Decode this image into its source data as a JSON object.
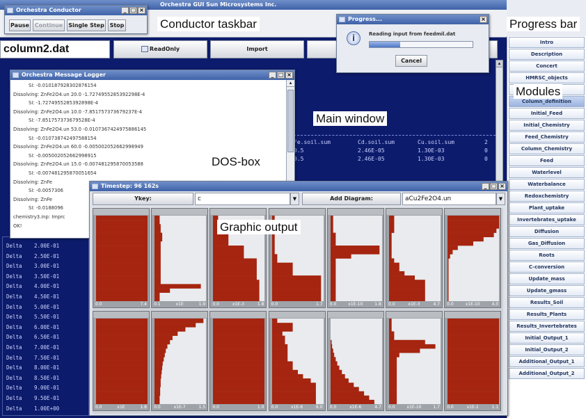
{
  "conductor": {
    "buttons": [
      "Pause",
      "Continue",
      "Single Step",
      "Stop"
    ],
    "annotation": "Conductor taskbar"
  },
  "main": {
    "title": "column2.dat",
    "readonly_label": "ReadOnly",
    "import_label": "Import",
    "annotation": "Main window",
    "table_rows": [
      [
        "Fe.soil.sum",
        "Cd.soil.sum",
        "Cu.soil.sum",
        "2"
      ],
      [
        "0.5",
        "2.46E-05",
        "1.30E-03",
        "0"
      ],
      [
        "0.5",
        "2.46E-05",
        "1.30E-03",
        "0"
      ]
    ]
  },
  "progress": {
    "title": "Progress...",
    "message": "Reading input from feedmil.dat",
    "cancel_label": "Cancel",
    "annotation": "Progress bar",
    "fraction": 0.3
  },
  "modules": {
    "annotation": "Modules",
    "items": [
      "Intro",
      "Description",
      "Concert",
      "HMRSC_objects",
      "",
      "Column_definition",
      "Initial_Feed",
      "Initial_Chemistry",
      "Feed_Chemistry",
      "Column_Chemistry",
      "Feed",
      "Waterlevel",
      "Waterbalance",
      "Redoxchemistry",
      "Plant_uptake",
      "Invertebrates_uptake",
      "Diffusion",
      "Gas_Diffusion",
      "Roots",
      "C-conversion",
      "Update_mass",
      "Update_gmass",
      "Results_Soil",
      "Results_Plants",
      "Results_Invertebrates",
      "Initial_Output_1",
      "Initial_Output_2",
      "Additional_Output_1",
      "Additional_Output_2"
    ]
  },
  "logger": {
    "title": "Orchestra Message Logger",
    "annotation": "DOS-box",
    "lines": [
      "SI: -0.010187928302876154",
      "Dissolving: ZnFe2O4.un 20.0 -1.7274955285392298E-4",
      "SI: -1.7274955285392898E-4",
      "Dissolving: ZnFe2O4.un 10.0 -7.851757373679237E-4",
      "SI: -7.851757373679528E-4",
      "Dissolving: ZnFe2O4.un 53.0 -0.0107367424975886145",
      "SI: -0.010738742497588154",
      "Dissolving: ZnFe2O4.un 60.0 -0.005002052662998949",
      "SI: -0.005002052662998915",
      "Dissolving: ZnFe2O4.un 15.0 -0.007481295870053588",
      "SI: -0.007481295870051654",
      "Dissolving: ZnFe",
      "SI: -0.0057306",
      "Dissolving: ZnFe",
      "SI: -0.0188096",
      "chemistry3.inp: Imprc",
      "OK!"
    ]
  },
  "dos": {
    "rows": [
      [
        "Delta",
        "2.00E-01"
      ],
      [
        "Delta",
        "2.50E-01"
      ],
      [
        "Delta",
        "3.00E-01"
      ],
      [
        "Delta",
        "3.50E-01"
      ],
      [
        "Delta",
        "4.00E-01"
      ],
      [
        "Delta",
        "4.50E-01"
      ],
      [
        "Delta",
        "5.00E-01"
      ],
      [
        "Delta",
        "5.50E-01"
      ],
      [
        "Delta",
        "6.00E-01"
      ],
      [
        "Delta",
        "6.50E-01"
      ],
      [
        "Delta",
        "7.00E-01"
      ],
      [
        "Delta",
        "7.50E-01"
      ],
      [
        "Delta",
        "8.00E-01"
      ],
      [
        "Delta",
        "8.50E-01"
      ],
      [
        "Delta",
        "9.00E-01"
      ],
      [
        "Delta",
        "9.50E-01"
      ],
      [
        "Delta",
        "1.00E+00"
      ]
    ]
  },
  "graphic": {
    "title": "Timestep: 96 162s",
    "ykey_label": "Ykey:",
    "ykey_value": "c",
    "add_label": "Add Diagram:",
    "add_value": "aCu2Fe2O4.un",
    "annotation": "Graphic output",
    "fill_color": "#a52510",
    "cells": [
      {
        "axis": [
          "0.0",
          "",
          "7.4"
        ],
        "profile": [
          1,
          1,
          1,
          1,
          1,
          1,
          1,
          1,
          1,
          1,
          1,
          1,
          1,
          1,
          1,
          1,
          1,
          1,
          1,
          1
        ]
      },
      {
        "axis": [
          "0.1",
          "x1E",
          "1.9"
        ],
        "profile": [
          0.1,
          0.1,
          0.12,
          0.12,
          0.15,
          0.15,
          0.12,
          0.12,
          0.12,
          0.12,
          0.12,
          0.12,
          0.12,
          0.12,
          0.12,
          0.12,
          0.9,
          0.3,
          0.1,
          0.1
        ]
      },
      {
        "axis": [
          "0.0",
          "x1E-3",
          "1.8"
        ],
        "profile": [
          0.1,
          0.1,
          0.1,
          0.1,
          0.3,
          0.3,
          0.3,
          0.6,
          0.6,
          0.6,
          0.85,
          0.85,
          0.85,
          0.85,
          0.85,
          0.9,
          0.9,
          0.9,
          0.9,
          0.9
        ]
      },
      {
        "axis": [
          "0.0",
          "",
          "1.7"
        ],
        "profile": [
          0.05,
          0.05,
          0.05,
          0.05,
          0.05,
          0.05,
          0.05,
          0.05,
          0.05,
          0.1,
          0.1,
          0.4,
          0.4,
          0.4,
          0.95,
          0.95,
          0.95,
          0.95,
          0.95,
          0.95
        ]
      },
      {
        "axis": [
          "0.0",
          "x1E-10",
          "1.8"
        ],
        "profile": [
          0.05,
          0.05,
          0.05,
          0.05,
          0.1,
          0.1,
          0.1,
          0.95,
          0.95,
          0.4,
          0.1,
          0.1,
          0.1,
          0.1,
          0.1,
          0.1,
          0.1,
          0.1,
          0.1,
          0.1
        ]
      },
      {
        "axis": [
          "0.0",
          "x1E-3",
          "4.7"
        ],
        "profile": [
          0.1,
          0.1,
          0.1,
          0.1,
          0.05,
          0.05,
          0.05,
          0.05,
          0.05,
          0.05,
          0.1,
          0.2,
          0.2,
          0.3,
          0.5,
          0.7,
          0.7,
          0.7,
          0.7,
          0.7
        ]
      },
      {
        "axis": [
          "0.0",
          "x1E-10",
          "4.0"
        ],
        "profile": [
          1,
          1,
          1,
          0.95,
          0.9,
          0.7,
          0.5,
          0.2,
          0.1,
          0.05,
          0.02,
          0.02,
          0.02,
          0.02,
          0.02,
          0.02,
          0.02,
          0.02,
          0.02,
          0.02
        ]
      },
      {
        "axis": [
          "0.0",
          "x1E",
          "1.8"
        ],
        "profile": [
          1,
          1,
          1,
          1,
          1,
          1,
          1,
          1,
          1,
          1,
          1,
          1,
          1,
          1,
          1,
          1,
          1,
          1,
          1,
          1
        ]
      },
      {
        "axis": [
          "0.0",
          "x1E-7",
          "1.5"
        ],
        "profile": [
          0.95,
          0.8,
          0.6,
          0.45,
          0.35,
          0.3,
          0.25,
          0.22,
          0.2,
          0.18,
          0.16,
          0.15,
          0.14,
          0.13,
          0.12,
          0.12,
          0.11,
          0.11,
          0.1,
          0.1
        ]
      },
      {
        "axis": [
          "0.0",
          "",
          "1.0"
        ],
        "profile": [
          1,
          1,
          1,
          1,
          1,
          1,
          1,
          1,
          1,
          1,
          1,
          1,
          1,
          1,
          1,
          1,
          1,
          1,
          1,
          1
        ]
      },
      {
        "axis": [
          "0.0",
          "x1E-6",
          "6.0"
        ],
        "profile": [
          0.1,
          0.4,
          0.4,
          0.2,
          0.25,
          0.25,
          0.3,
          0.3,
          0.3,
          0.3,
          0.4,
          0.4,
          0.5,
          0.6,
          0.75,
          0.85,
          0.85,
          0.85,
          0.85,
          0.85
        ]
      },
      {
        "axis": [
          "0.0",
          "x1E-6",
          "4.7"
        ],
        "profile": [
          0,
          0,
          0,
          0,
          0,
          0.02,
          0.03,
          0.05,
          0.07,
          0.1,
          0.13,
          0.17,
          0.22,
          0.28,
          0.35,
          0.45,
          0.55,
          0.65,
          0.75,
          0.85
        ]
      },
      {
        "axis": [
          "0.0",
          "x1E-10",
          "1.7"
        ],
        "profile": [
          0.05,
          0.05,
          0.05,
          0.1,
          0.1,
          0.7,
          0.9,
          0.6,
          0.2,
          0.15,
          0.15,
          0.15,
          0.15,
          0.15,
          0.15,
          0.15,
          0.15,
          0.15,
          0.15,
          0.15
        ]
      },
      {
        "axis": [
          "0.0",
          "x1E-1",
          "1.1"
        ],
        "profile": [
          1,
          1,
          1,
          1,
          1,
          1,
          1,
          1,
          1,
          1,
          1,
          1,
          1,
          1,
          1,
          1,
          1,
          1,
          1,
          1
        ]
      }
    ]
  }
}
